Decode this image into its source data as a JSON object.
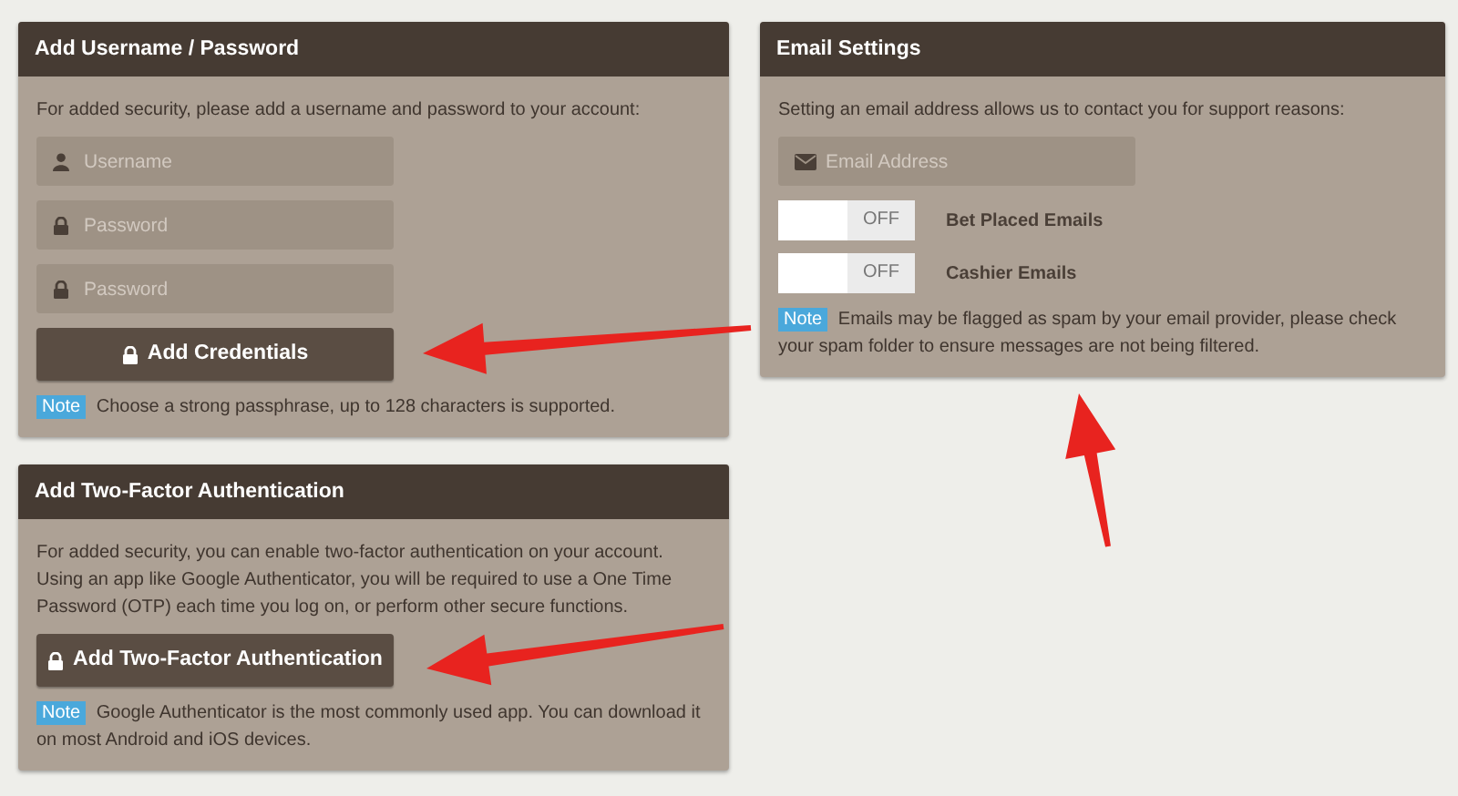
{
  "left_column": [
    {
      "title": "Add Username / Password",
      "intro": "For added security, please add a username and password to your account:",
      "fields": [
        {
          "kind": "username",
          "placeholder": "Username"
        },
        {
          "kind": "password",
          "placeholder": "Password"
        },
        {
          "kind": "password",
          "placeholder": "Password"
        }
      ],
      "button": {
        "label": "Add Credentials"
      },
      "note": {
        "badge": "Note",
        "text": "Choose a strong passphrase, up to 128 characters is supported."
      }
    },
    {
      "title": "Add Two-Factor Authentication",
      "intro": "For added security, you can enable two-factor authentication on your account. Using an app like Google Authenticator, you will be required to use a One Time Password (OTP) each time you log on, or perform other secure functions.",
      "button": {
        "label": "Add Two-Factor Authentication"
      },
      "note": {
        "badge": "Note",
        "text": "Google Authenticator is the most commonly used app. You can download it on most Android and iOS devices."
      }
    }
  ],
  "right_column": [
    {
      "title": "Email Settings",
      "intro": "Setting an email address allows us to contact you for support reasons:",
      "fields": [
        {
          "kind": "email",
          "placeholder": "Email Address"
        }
      ],
      "toggles": [
        {
          "state_text": "OFF",
          "on": false,
          "label": "Bet Placed Emails"
        },
        {
          "state_text": "OFF",
          "on": false,
          "label": "Cashier Emails"
        }
      ],
      "note": {
        "badge": "Note",
        "text": "Emails may be flagged as spam by your email provider, please check your spam folder to ensure messages are not being filtered."
      }
    }
  ]
}
